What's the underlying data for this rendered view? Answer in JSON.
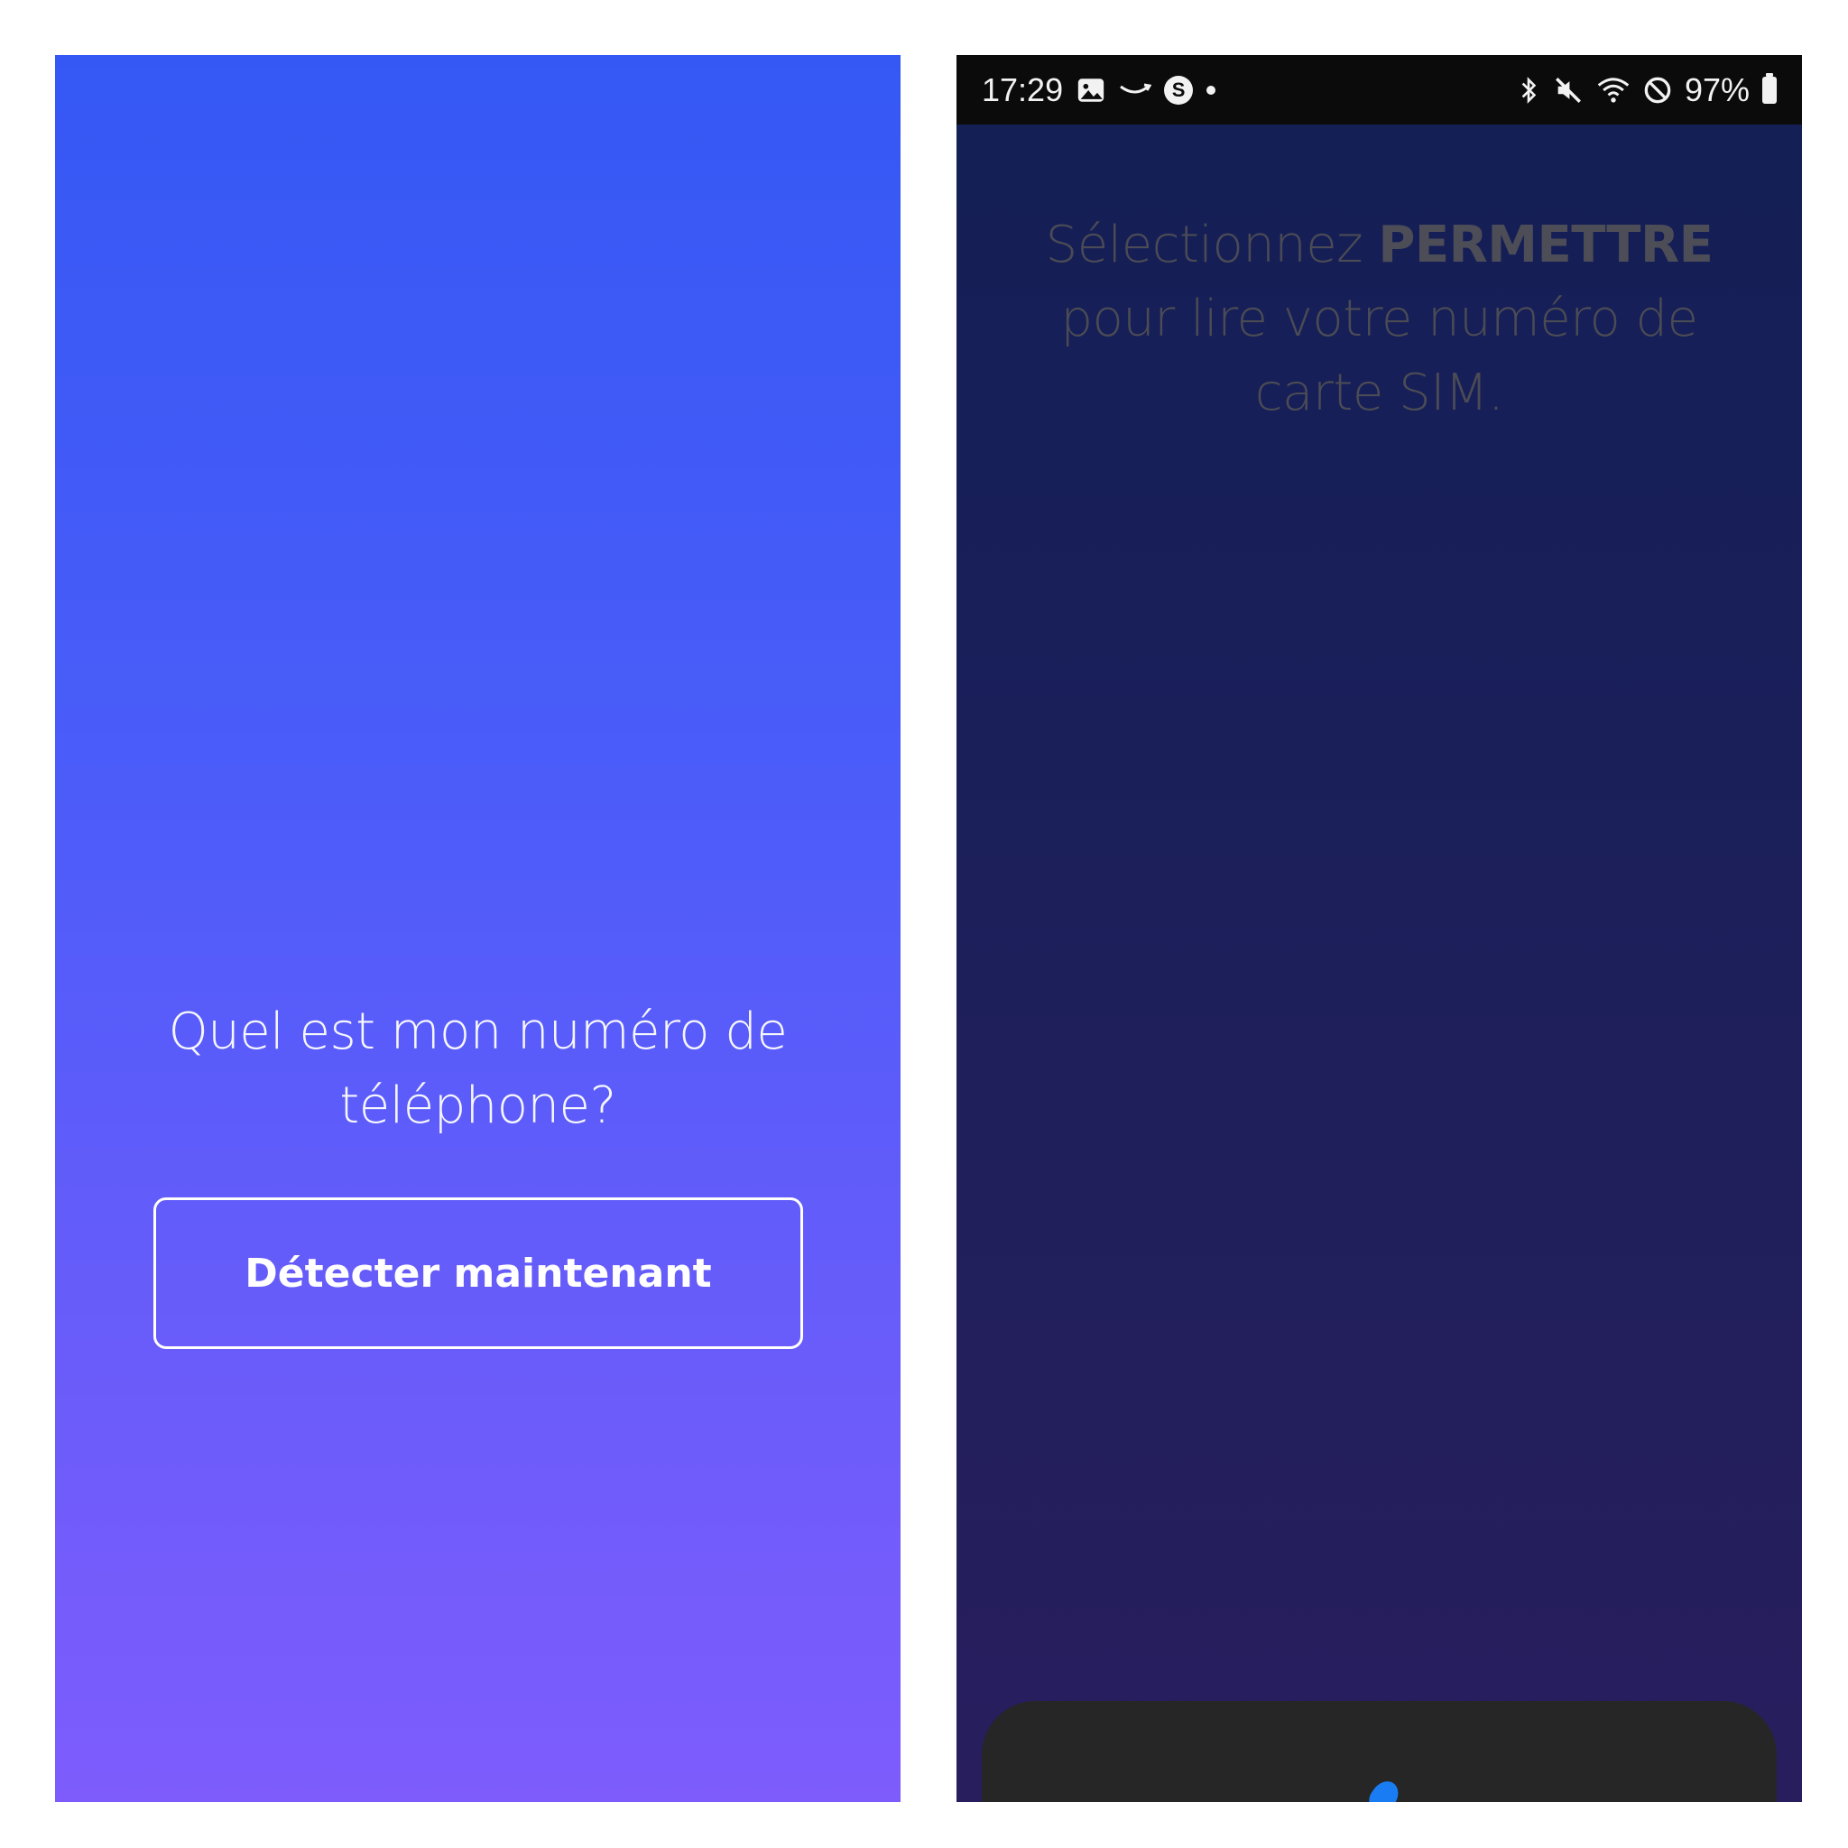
{
  "left_screen": {
    "question": "Quel est mon numéro de téléphone?",
    "detect_button_label": "Détecter maintenant"
  },
  "right_screen": {
    "status_bar": {
      "time": "17:29",
      "battery": "97%",
      "icons_left": [
        "gallery-icon",
        "amazon-icon",
        "skype-icon",
        "notification-dot-icon"
      ],
      "icons_right": [
        "bluetooth-icon",
        "mute-icon",
        "wifi-icon",
        "do-not-disturb-icon",
        "battery-icon"
      ],
      "skype_letter": "S"
    },
    "instruction_pre": "Sélectionnez ",
    "instruction_bold": "PERMETTRE",
    "instruction_post": " pour lire votre numéro de carte SIM."
  },
  "colors": {
    "left_gradient_top": "#3558f4",
    "left_gradient_bottom": "#7e5cfc",
    "right_gradient_top": "#131f55",
    "right_gradient_bottom": "#281e5e",
    "spinner": "#1a7cf2"
  }
}
